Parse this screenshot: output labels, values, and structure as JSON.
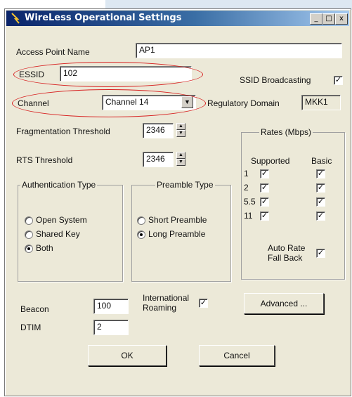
{
  "window": {
    "title": "WireLess Operational Settings",
    "min_btn": "_",
    "max_btn": "□",
    "close_btn": "x"
  },
  "ap_name": {
    "label": "Access Point Name",
    "value": "AP1"
  },
  "essid": {
    "label": "ESSID",
    "value": "102"
  },
  "ssid_broadcast": {
    "label": "SSID Broadcasting",
    "checked": true
  },
  "channel": {
    "label": "Channel",
    "value": "Channel 14"
  },
  "regulatory": {
    "label": "Regulatory Domain",
    "value": "MKK1"
  },
  "frag": {
    "label": "Fragmentation Threshold",
    "value": "2346"
  },
  "rts": {
    "label": "RTS Threshold",
    "value": "2346"
  },
  "rates": {
    "title": "Rates (Mbps)",
    "col_supported": "Supported",
    "col_basic": "Basic",
    "rows": [
      {
        "rate": "1",
        "supported": true,
        "basic": true
      },
      {
        "rate": "2",
        "supported": true,
        "basic": true
      },
      {
        "rate": "5.5",
        "supported": true,
        "basic": true
      },
      {
        "rate": "11",
        "supported": true,
        "basic": true
      }
    ],
    "auto_rate_line1": "Auto Rate",
    "auto_rate_line2": "Fall Back",
    "auto_rate_checked": true
  },
  "auth": {
    "title": "Authentication Type",
    "options": [
      "Open System",
      "Shared Key",
      "Both"
    ],
    "selected": "Both"
  },
  "preamble": {
    "title": "Preamble Type",
    "options": [
      "Short Preamble",
      "Long Preamble"
    ],
    "selected": "Long Preamble"
  },
  "beacon": {
    "label": "Beacon",
    "value": "100"
  },
  "dtim": {
    "label": "DTIM",
    "value": "2"
  },
  "intl_roaming": {
    "line1": "International",
    "line2": "Roaming",
    "checked": true
  },
  "buttons": {
    "advanced": "Advanced ...",
    "ok": "OK",
    "cancel": "Cancel"
  },
  "check_glyph": "✓",
  "colors": {
    "highlight_ellipse": "#d72020",
    "titlebar": "#0a246a"
  }
}
